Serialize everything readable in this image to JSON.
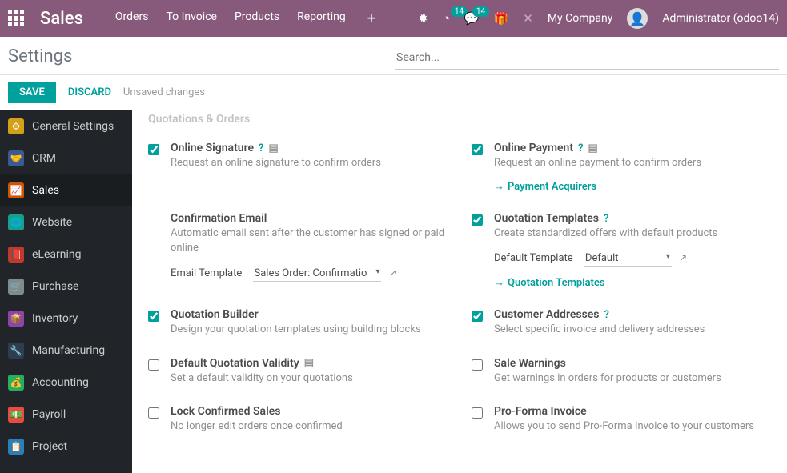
{
  "navbar": {
    "brand": "Sales",
    "links": [
      "Orders",
      "To Invoice",
      "Products",
      "Reporting"
    ],
    "badge1": "14",
    "badge2": "14",
    "company": "My Company",
    "user": "Administrator (odoo14)"
  },
  "control": {
    "title": "Settings",
    "search_placeholder": "Search..."
  },
  "buttons": {
    "save": "SAVE",
    "discard": "DISCARD",
    "status": "Unsaved changes"
  },
  "sidebar": {
    "items": [
      {
        "label": "General Settings"
      },
      {
        "label": "CRM"
      },
      {
        "label": "Sales"
      },
      {
        "label": "Website"
      },
      {
        "label": "eLearning"
      },
      {
        "label": "Purchase"
      },
      {
        "label": "Inventory"
      },
      {
        "label": "Manufacturing"
      },
      {
        "label": "Accounting"
      },
      {
        "label": "Payroll"
      },
      {
        "label": "Project"
      }
    ]
  },
  "section": {
    "cut_title": "Quotations & Orders"
  },
  "settings": {
    "online_sig": {
      "label": "Online Signature",
      "desc": "Request an online signature to confirm orders",
      "checked": true
    },
    "online_pay": {
      "label": "Online Payment",
      "desc": "Request an online payment to confirm orders",
      "checked": true,
      "link": "Payment Acquirers"
    },
    "conf_email": {
      "label": "Confirmation Email",
      "desc": "Automatic email sent after the customer has signed or paid online",
      "sub_label": "Email Template",
      "sub_value": "Sales Order: Confirmatio"
    },
    "quote_tmpl": {
      "label": "Quotation Templates",
      "desc": "Create standardized offers with default products",
      "checked": true,
      "sub_label": "Default Template",
      "sub_value": "Default",
      "link": "Quotation Templates"
    },
    "quote_builder": {
      "label": "Quotation Builder",
      "desc": "Design your quotation templates using building blocks",
      "checked": true
    },
    "cust_addr": {
      "label": "Customer Addresses",
      "desc": "Select specific invoice and delivery addresses",
      "checked": true
    },
    "def_valid": {
      "label": "Default Quotation Validity",
      "desc": "Set a default validity on your quotations",
      "checked": false
    },
    "sale_warn": {
      "label": "Sale Warnings",
      "desc": "Get warnings in orders for products or customers",
      "checked": false
    },
    "lock_conf": {
      "label": "Lock Confirmed Sales",
      "desc": "No longer edit orders once confirmed",
      "checked": false
    },
    "proforma": {
      "label": "Pro-Forma Invoice",
      "desc": "Allows you to send Pro-Forma Invoice to your customers",
      "checked": false
    }
  }
}
